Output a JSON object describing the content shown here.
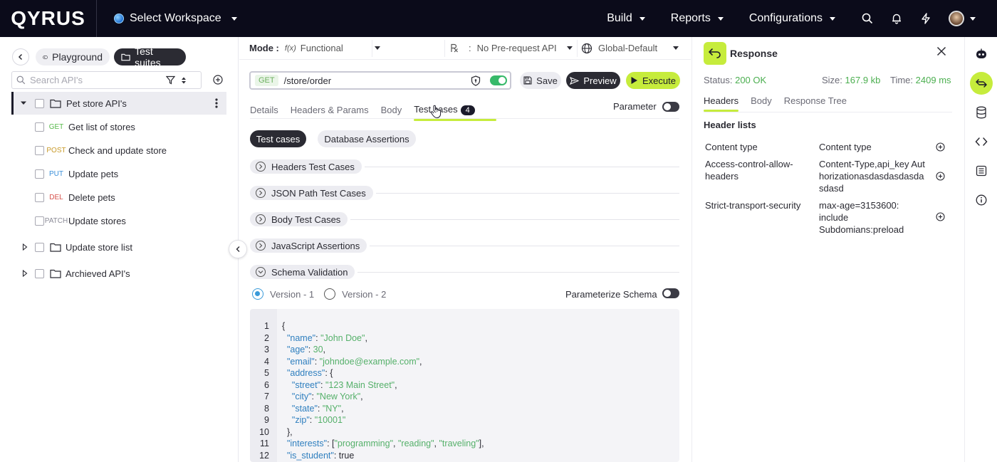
{
  "topbar": {
    "logo": "QYRUS",
    "workspace": "Select Workspace",
    "nav": [
      "Build",
      "Reports",
      "Configurations"
    ],
    "icons": [
      "search-icon",
      "bell-icon",
      "lightning-icon",
      "avatar"
    ]
  },
  "sidebar": {
    "tabs": {
      "playground": "Playground",
      "test_suites": "Test suites"
    },
    "search_placeholder": "Search API's",
    "tree": [
      {
        "label": "Pet store API's",
        "type": "folder",
        "expanded": true,
        "selected": true
      },
      {
        "label": "Get list of stores",
        "method": "GET"
      },
      {
        "label": "Check and update store",
        "method": "POST"
      },
      {
        "label": "Update pets",
        "method": "PUT"
      },
      {
        "label": "Delete pets",
        "method": "DEL"
      },
      {
        "label": "Update stores",
        "method": "PATCH"
      },
      {
        "label": "Update store list",
        "type": "folder",
        "expanded": false
      },
      {
        "label": "Archieved API's",
        "type": "folder",
        "expanded": false
      }
    ]
  },
  "request": {
    "mode_label": "Mode :",
    "mode_value": "Functional",
    "prerequest_sep": ":",
    "prerequest": "No Pre-request API",
    "environment": "Global-Default",
    "method": "GET",
    "url": "/store/order",
    "buttons": {
      "save": "Save",
      "preview": "Preview",
      "execute": "Execute"
    },
    "tabs": [
      "Details",
      "Headers & Params",
      "Body",
      "Test cases"
    ],
    "test_case_count": "4",
    "parameter_label": "Parameter",
    "chips": {
      "test_cases": "Test cases",
      "db_assertions": "Database Assertions"
    },
    "sections": [
      "Headers Test Cases",
      "JSON Path Test Cases",
      "Body Test Cases",
      "JavaScript Assertions",
      "Schema Validation"
    ],
    "versions": [
      "Version - 1",
      "Version - 2"
    ],
    "parameterize_schema": "Parameterize Schema"
  },
  "code": {
    "line_numbers": [
      "1",
      "2",
      "3",
      "4",
      "5",
      "6",
      "7",
      "8",
      "9",
      "10",
      "11",
      "12"
    ],
    "keys": {
      "name": "\"name\"",
      "age": "\"age\"",
      "email": "\"email\"",
      "address": "\"address\"",
      "street": "\"street\"",
      "city": "\"city\"",
      "state": "\"state\"",
      "zip": "\"zip\"",
      "interests": "\"interests\"",
      "is_student": "\"is_student\""
    },
    "values": {
      "name": "\"John Doe\"",
      "age": "30",
      "email": "\"johndoe@example.com\"",
      "street": "\"123 Main Street\"",
      "city": "\"New York\"",
      "state": "\"NY\"",
      "zip": "\"10001\"",
      "interests_1": "\"programming\"",
      "interests_2": "\"reading\"",
      "interests_3": "\"traveling\"",
      "is_student": "true"
    }
  },
  "response": {
    "title": "Response",
    "status_label": "Status:",
    "status": "200 OK",
    "size_label": "Size:",
    "size": "167.9 kb",
    "time_label": "Time:",
    "time": "2409 ms",
    "tabs": [
      "Headers",
      "Body",
      "Response Tree"
    ],
    "header_lists_title": "Header lists",
    "headers": [
      {
        "key": "Content type",
        "value": "Content type"
      },
      {
        "key": "Access-control-allow-headers",
        "value": "Content-Type,api_key Authorizationasdasdasdasdasdasd"
      },
      {
        "key": "Strict-transport-security",
        "value": "max-age=3153600: include Subdomians:preload"
      }
    ]
  },
  "colors": {
    "accent": "#c6ec3c",
    "dark": "#2b2b33",
    "topbar": "#0b0b1a",
    "success": "#4caf50"
  }
}
